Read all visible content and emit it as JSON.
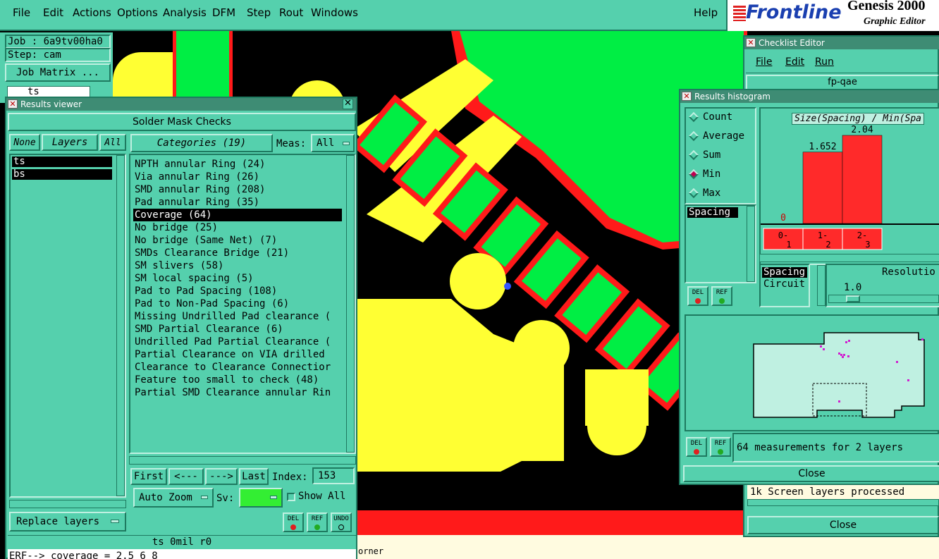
{
  "menubar": {
    "items": [
      "File",
      "Edit",
      "Actions",
      "Options",
      "Analysis",
      "DFM",
      "Step",
      "Rout",
      "Windows"
    ],
    "help": "Help"
  },
  "brand": {
    "logo": "Frontline",
    "product": "Genesis 2000",
    "subtitle": "Graphic Editor"
  },
  "left_panel": {
    "job": "Job : 6a9tv00ha0",
    "step": "Step: cam",
    "job_matrix": "Job Matrix ...",
    "layer_stub": "ts"
  },
  "results_viewer": {
    "title": "Results viewer",
    "heading": "Solder Mask Checks",
    "layers_none": "None",
    "layers_label": "Layers",
    "layers_all": "All",
    "layers": [
      "ts",
      "bs"
    ],
    "categories_label": "Categories (19)",
    "meas_label": "Meas:",
    "meas_value": "All",
    "categories": [
      "NPTH annular Ring (24)",
      "Via annular Ring (26)",
      "SMD annular Ring (208)",
      "Pad annular Ring (35)",
      "Coverage (64)",
      "No bridge (25)",
      "No bridge (Same Net) (7)",
      "SMDs Clearance Bridge (21)",
      "SM slivers (58)",
      "SM local spacing (5)",
      "Pad to Pad Spacing (108)",
      "Pad to Non-Pad Spacing (6)",
      "Missing Undrilled Pad clearance (",
      "SMD Partial Clearance (6)",
      "Undrilled Pad Partial Clearance (",
      "Partial Clearance on VIA drilled",
      "Clearance to Clearance Connectior",
      "Feature too small to check (48)",
      "Partial SMD Clearance annular Rin"
    ],
    "selected_category": "Coverage (64)",
    "first": "First",
    "prev": "<---",
    "next": "--->",
    "last": "Last",
    "index_label": "Index:",
    "index_value": "153",
    "auto_zoom": "Auto Zoom",
    "sv_label": "Sv:",
    "show_all": "Show All",
    "replace_layers": "Replace layers",
    "del": "DEL",
    "ref": "REF",
    "undo": "UNDO",
    "status": "ts 0mil  r0",
    "erf": "ERF--> coverage = 2.5 6 8"
  },
  "checklist_editor": {
    "title": "Checklist Editor",
    "menu": [
      "File",
      "Edit",
      "Run"
    ],
    "name": "fp-qae",
    "log": "1k Screen layers processed",
    "close": "Close"
  },
  "histogram": {
    "title": "Results histogram",
    "modes": [
      "Count",
      "Average",
      "Sum",
      "Min",
      "Max"
    ],
    "selected_mode": "Min",
    "list_item": "Spacing",
    "chart_title": "Size(Spacing) / Min(Spa",
    "types": [
      "Spacing",
      "Circuit"
    ],
    "resolution_label": "Resolutio",
    "resolution_value": "1.0",
    "summary": "64 measurements for 2 layers",
    "close": "Close",
    "del": "DEL",
    "ref": "REF"
  },
  "chart_data": {
    "type": "bar",
    "title": "Size(Spacing) / Min(Spa",
    "categories": [
      "0-1",
      "1-2",
      "2-3"
    ],
    "values": [
      0,
      1.652,
      2.04
    ],
    "value_labels": [
      "0",
      "1.652",
      "2.04"
    ],
    "bar_color": "#ff2a2a"
  },
  "bottom_status": "orner"
}
